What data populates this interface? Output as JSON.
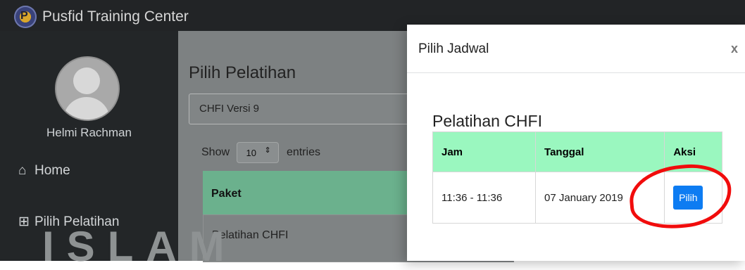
{
  "topbar": {
    "brand": "Pusfid Training Center"
  },
  "sidebar": {
    "user_name": "Helmi Rachman",
    "items": [
      {
        "label": "Home"
      },
      {
        "label": "Pilih Pelatihan"
      }
    ]
  },
  "main": {
    "title": "Pilih Pelatihan",
    "selected_training": "CHFI Versi 9",
    "show_label": "Show",
    "entries_label": "entries",
    "entries_value": "10",
    "table_header": "Paket",
    "table_row": "Pelatihan CHFI"
  },
  "modal": {
    "title": "Pilih Jadwal",
    "close": "x",
    "subtitle": "Pelatihan CHFI",
    "columns": [
      "Jam",
      "Tanggal",
      "Aksi"
    ],
    "rows": [
      {
        "jam": "11:36 - 11:36",
        "tanggal": "07 January 2019",
        "aksi": "Pilih"
      }
    ]
  },
  "colors": {
    "accent": "#9af7bf",
    "button": "#0d7cf2",
    "highlight": "#f10c0c"
  }
}
